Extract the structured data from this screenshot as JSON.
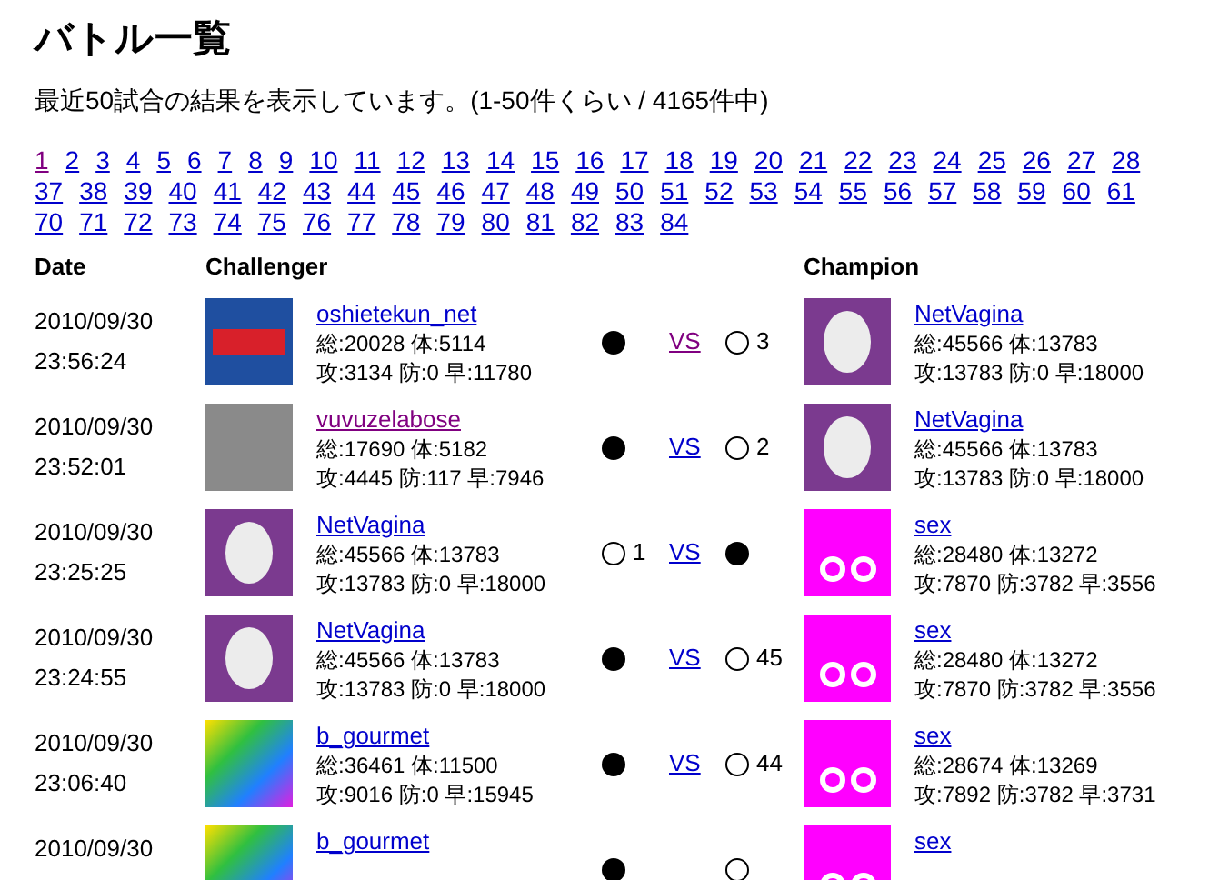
{
  "title": "バトル一覧",
  "summary": "最近50試合の結果を表示しています。(1-50件くらい / 4165件中)",
  "pages": [
    [
      {
        "label": "1",
        "visited": true
      },
      {
        "label": "2",
        "visited": false
      },
      {
        "label": "3",
        "visited": false
      },
      {
        "label": "4",
        "visited": false
      },
      {
        "label": "5",
        "visited": false
      },
      {
        "label": "6",
        "visited": false
      },
      {
        "label": "7",
        "visited": false
      },
      {
        "label": "8",
        "visited": false
      },
      {
        "label": "9",
        "visited": false
      },
      {
        "label": "10",
        "visited": false
      },
      {
        "label": "11",
        "visited": false
      },
      {
        "label": "12",
        "visited": false
      },
      {
        "label": "13",
        "visited": false
      },
      {
        "label": "14",
        "visited": false
      },
      {
        "label": "15",
        "visited": false
      },
      {
        "label": "16",
        "visited": false
      },
      {
        "label": "17",
        "visited": false
      },
      {
        "label": "18",
        "visited": false
      },
      {
        "label": "19",
        "visited": false
      },
      {
        "label": "20",
        "visited": false
      },
      {
        "label": "21",
        "visited": false
      },
      {
        "label": "22",
        "visited": false
      },
      {
        "label": "23",
        "visited": false
      },
      {
        "label": "24",
        "visited": false
      },
      {
        "label": "25",
        "visited": false
      },
      {
        "label": "26",
        "visited": false
      },
      {
        "label": "27",
        "visited": false
      },
      {
        "label": "28",
        "visited": false
      }
    ],
    [
      {
        "label": "37",
        "visited": false
      },
      {
        "label": "38",
        "visited": false
      },
      {
        "label": "39",
        "visited": false
      },
      {
        "label": "40",
        "visited": false
      },
      {
        "label": "41",
        "visited": false
      },
      {
        "label": "42",
        "visited": false
      },
      {
        "label": "43",
        "visited": false
      },
      {
        "label": "44",
        "visited": false
      },
      {
        "label": "45",
        "visited": false
      },
      {
        "label": "46",
        "visited": false
      },
      {
        "label": "47",
        "visited": false
      },
      {
        "label": "48",
        "visited": false
      },
      {
        "label": "49",
        "visited": false
      },
      {
        "label": "50",
        "visited": false
      },
      {
        "label": "51",
        "visited": false
      },
      {
        "label": "52",
        "visited": false
      },
      {
        "label": "53",
        "visited": false
      },
      {
        "label": "54",
        "visited": false
      },
      {
        "label": "55",
        "visited": false
      },
      {
        "label": "56",
        "visited": false
      },
      {
        "label": "57",
        "visited": false
      },
      {
        "label": "58",
        "visited": false
      },
      {
        "label": "59",
        "visited": false
      },
      {
        "label": "60",
        "visited": false
      },
      {
        "label": "61",
        "visited": false
      }
    ],
    [
      {
        "label": "70",
        "visited": false
      },
      {
        "label": "71",
        "visited": false
      },
      {
        "label": "72",
        "visited": false
      },
      {
        "label": "73",
        "visited": false
      },
      {
        "label": "74",
        "visited": false
      },
      {
        "label": "75",
        "visited": false
      },
      {
        "label": "76",
        "visited": false
      },
      {
        "label": "77",
        "visited": false
      },
      {
        "label": "78",
        "visited": false
      },
      {
        "label": "79",
        "visited": false
      },
      {
        "label": "80",
        "visited": false
      },
      {
        "label": "81",
        "visited": false
      },
      {
        "label": "82",
        "visited": false
      },
      {
        "label": "83",
        "visited": false
      },
      {
        "label": "84",
        "visited": false
      }
    ]
  ],
  "columns": {
    "date": "Date",
    "challenger": "Challenger",
    "champion": "Champion"
  },
  "battles": [
    {
      "date": "2010/09/30",
      "time": "23:56:24",
      "challenger": {
        "kind": "blue",
        "name": "oshietekun_net",
        "visited": false,
        "line1": "総:20028 体:5114",
        "line2": "攻:3134 防:0 早:11780"
      },
      "challenger_won": true,
      "vs": "VS",
      "vs_visited": true,
      "count": "3",
      "champion": {
        "kind": "egg",
        "name": "NetVagina",
        "visited": false,
        "line1": "総:45566 体:13783",
        "line2": "攻:13783 防:0 早:18000"
      }
    },
    {
      "date": "2010/09/30",
      "time": "23:52:01",
      "challenger": {
        "kind": "photo",
        "name": "vuvuzelabose",
        "visited": true,
        "line1": "総:17690 体:5182",
        "line2": "攻:4445 防:117 早:7946"
      },
      "challenger_won": true,
      "vs": "VS",
      "vs_visited": false,
      "count": "2",
      "champion": {
        "kind": "egg",
        "name": "NetVagina",
        "visited": false,
        "line1": "総:45566 体:13783",
        "line2": "攻:13783 防:0 早:18000"
      }
    },
    {
      "date": "2010/09/30",
      "time": "23:25:25",
      "challenger": {
        "kind": "egg",
        "name": "NetVagina",
        "visited": false,
        "line1": "総:45566 体:13783",
        "line2": "攻:13783 防:0 早:18000"
      },
      "challenger_won": false,
      "vs": "VS",
      "vs_visited": false,
      "count": "1",
      "champion": {
        "kind": "owl",
        "name": "sex",
        "visited": false,
        "line1": "総:28480 体:13272",
        "line2": "攻:7870 防:3782 早:3556"
      }
    },
    {
      "date": "2010/09/30",
      "time": "23:24:55",
      "challenger": {
        "kind": "egg",
        "name": "NetVagina",
        "visited": false,
        "line1": "総:45566 体:13783",
        "line2": "攻:13783 防:0 早:18000"
      },
      "challenger_won": true,
      "vs": "VS",
      "vs_visited": false,
      "count": "45",
      "champion": {
        "kind": "owl",
        "name": "sex",
        "visited": false,
        "line1": "総:28480 体:13272",
        "line2": "攻:7870 防:3782 早:3556"
      }
    },
    {
      "date": "2010/09/30",
      "time": "23:06:40",
      "challenger": {
        "kind": "gradient",
        "name": "b_gourmet",
        "visited": false,
        "line1": "総:36461 体:11500",
        "line2": "攻:9016 防:0 早:15945"
      },
      "challenger_won": true,
      "vs": "VS",
      "vs_visited": false,
      "count": "44",
      "champion": {
        "kind": "owl",
        "name": "sex",
        "visited": false,
        "line1": "総:28674 体:13269",
        "line2": "攻:7892 防:3782 早:3731"
      }
    },
    {
      "date": "2010/09/30",
      "challenger": {
        "kind": "gradient",
        "name": "b_gourmet",
        "visited": false
      },
      "challenger_won": true,
      "champion": {
        "kind": "owl",
        "name": "sex",
        "visited": false
      }
    }
  ]
}
